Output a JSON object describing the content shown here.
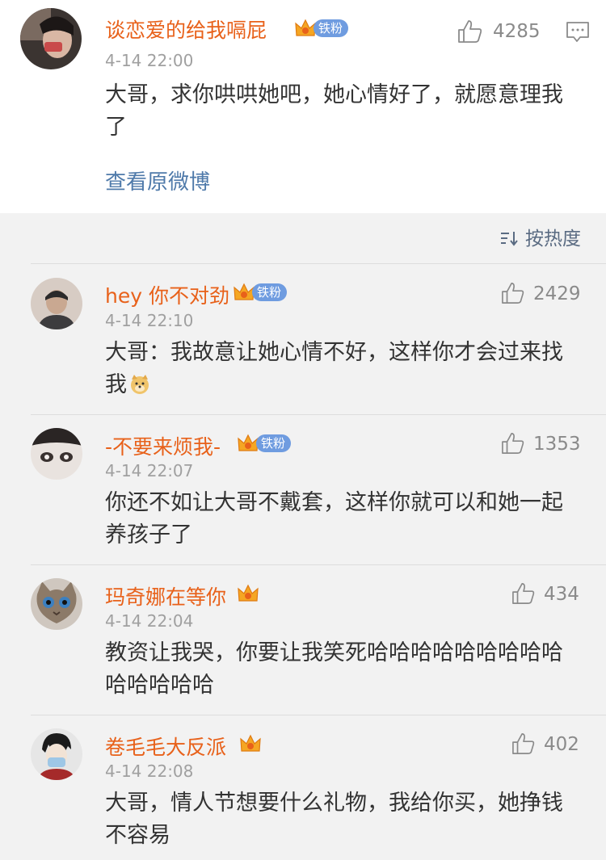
{
  "main_post": {
    "username": "谈恋爱的给我嗝屁",
    "badge": "铁粉",
    "time": "4-14 22:00",
    "text": "大哥，求你哄哄她吧，她心情好了，就愿意理我了",
    "likes": "4285",
    "view_original": "查看原微博"
  },
  "sort": {
    "label": "按热度"
  },
  "replies": [
    {
      "username": "hey 你不对劲",
      "badge": "铁粉",
      "time": "4-14 22:10",
      "text": "大哥：我故意让她心情不好，这样你才会过来找我",
      "emoji": "doge-emoji",
      "likes": "2429"
    },
    {
      "username": "-不要来烦我-",
      "badge": "铁粉",
      "time": "4-14 22:07",
      "text": "你还不如让大哥不戴套，这样你就可以和她一起养孩子了",
      "likes": "1353"
    },
    {
      "username": "玛奇娜在等你",
      "badge": "",
      "time": "4-14 22:04",
      "text": "教资让我哭，你要让我笑死哈哈哈哈哈哈哈哈哈哈哈哈哈哈",
      "likes": "434"
    },
    {
      "username": "卷毛毛大反派",
      "badge": "",
      "time": "4-14 22:08",
      "text": "大哥，情人节想要什么礼物，我给你买，她挣钱不容易",
      "likes": "402"
    }
  ],
  "colors": {
    "username": "#e8611a",
    "badge_bg": "#6f9ce0",
    "link": "#4f7aaa",
    "meta": "#a0a0a0"
  }
}
